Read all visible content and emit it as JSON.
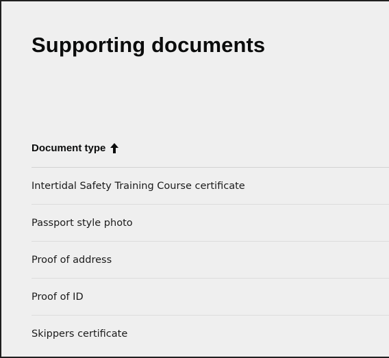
{
  "page": {
    "title": "Supporting documents"
  },
  "table": {
    "header": {
      "label": "Document type",
      "sort_icon": "arrow-up-icon",
      "sort_direction": "ascending"
    },
    "rows": [
      "Intertidal Safety Training Course certificate",
      "Passport style photo",
      "Proof of address",
      "Proof of ID",
      "Skippers certificate"
    ]
  }
}
